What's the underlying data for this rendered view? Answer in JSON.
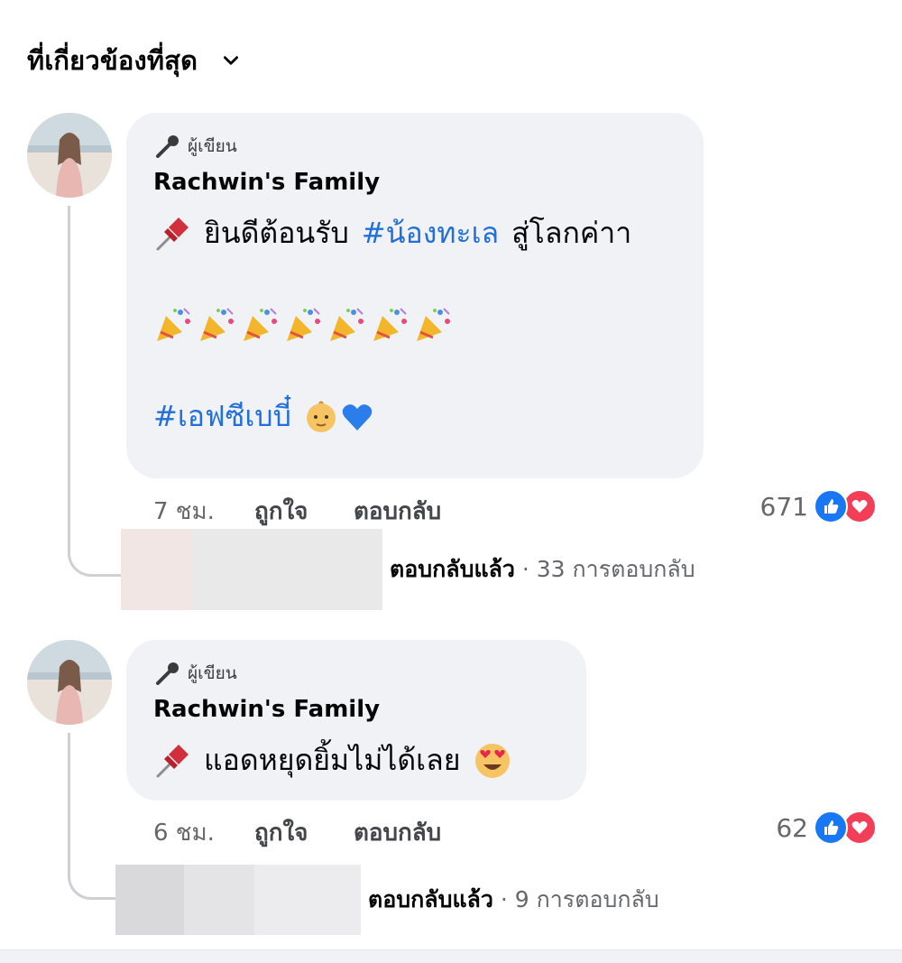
{
  "sort": {
    "label": "ที่เกี่ยวข้องที่สุด"
  },
  "comments": [
    {
      "badge": "ผู้เขียน",
      "author": "Rachwin's Family",
      "text_prefix": "ยินดีต้อนรับ",
      "hashtag1": "#น้องทะเล",
      "text_suffix": "สู่โลกค่าา",
      "hashtag2": "#เอฟซีเบบี๋",
      "time": "7 ชม.",
      "like": "ถูกใจ",
      "reply": "ตอบกลับ",
      "reaction_count": "671",
      "replied_label": "ตอบกลับแล้ว",
      "replies_count": "33 การตอบกลับ"
    },
    {
      "badge": "ผู้เขียน",
      "author": "Rachwin's Family",
      "text": "แอดหยุดยิ้มไม่ได้เลย",
      "time": "6 ชม.",
      "like": "ถูกใจ",
      "reply": "ตอบกลับ",
      "reaction_count": "62",
      "replied_label": "ตอบกลับแล้ว",
      "replies_count": "9 การตอบกลับ"
    }
  ],
  "colors": {
    "link": "#216fdb",
    "like_blue": "#1877f2",
    "love_red": "#f33e58",
    "bubble": "#f0f2f5"
  },
  "icons": [
    "chevron-down-icon",
    "microphone-icon",
    "pushpin-icon",
    "party-popper-icon",
    "baby-face-icon",
    "blue-heart-icon",
    "heart-eyes-icon",
    "like-reaction-icon",
    "love-reaction-icon"
  ]
}
